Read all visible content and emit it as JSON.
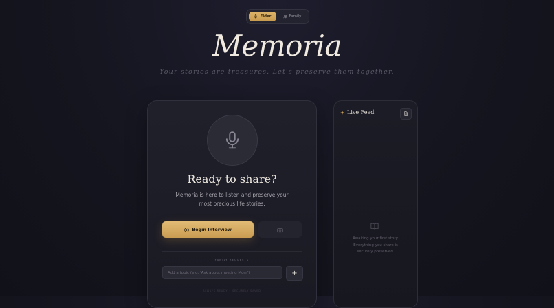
{
  "mode_toggle": {
    "elder_label": "Elder",
    "family_label": "Family",
    "active": "Elder"
  },
  "header": {
    "logo": "Memoria",
    "tagline": "Your stories are treasures. Let's preserve them together."
  },
  "session": {
    "heading": "Ready to share?",
    "description": "Memoria is here to listen and preserve your most precious life stories.",
    "begin_label": "Begin Interview",
    "family_requests_label": "FAMILY REQUESTS",
    "topic_placeholder": "Add a topic (e.g. 'Ask about meeting Mom')",
    "add_label": "+",
    "footer_note": "ALWAYS READY • SECURELY SAVED"
  },
  "feed": {
    "title": "Live Feed",
    "empty_line1": "Awaiting your first story.",
    "empty_line2": "Everything you share is",
    "empty_line3": "securely preserved."
  },
  "colors": {
    "accent_gold": "#d4a85e",
    "background": "#15151f",
    "card": "#1f1f2a"
  },
  "icons": {
    "elder": "microphone-icon",
    "family": "people-icon",
    "main": "microphone-icon",
    "begin": "play-circle-icon",
    "camera": "camera-icon",
    "feed": "sparkle-icon",
    "export": "document-icon",
    "empty": "open-book-icon"
  }
}
